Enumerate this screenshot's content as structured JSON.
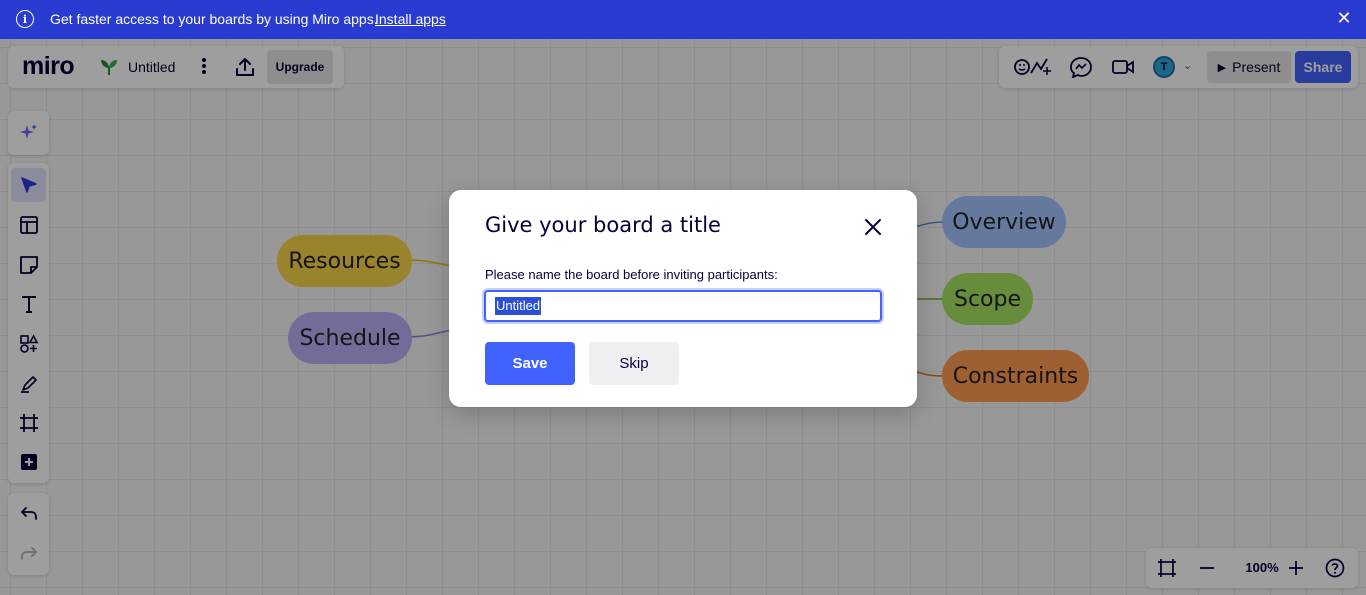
{
  "banner": {
    "message": "Get faster access to your boards by using Miro apps.",
    "link": "Install apps"
  },
  "board_bar": {
    "logo": "miro",
    "board_name": "Untitled",
    "upgrade_label": "Upgrade"
  },
  "right_bar": {
    "avatar_initial": "T",
    "present_label": "Present",
    "share_label": "Share"
  },
  "mindmap": {
    "nodes": [
      {
        "label": "Resources",
        "color": "#f7d34a"
      },
      {
        "label": "Schedule",
        "color": "#b9aef5"
      },
      {
        "label": "Overview",
        "color": "#a4c3ff"
      },
      {
        "label": "Scope",
        "color": "#a6e25f"
      },
      {
        "label": "Constraints",
        "color": "#ff9c4f"
      }
    ]
  },
  "zoom": {
    "level": "100%"
  },
  "modal": {
    "title": "Give your board a title",
    "label": "Please name the board before inviting participants:",
    "input_value": "Untitled",
    "save_label": "Save",
    "skip_label": "Skip"
  },
  "colors": {
    "banner": "#2a3bd1",
    "primary": "#4262ff",
    "text_dark": "#050038"
  }
}
